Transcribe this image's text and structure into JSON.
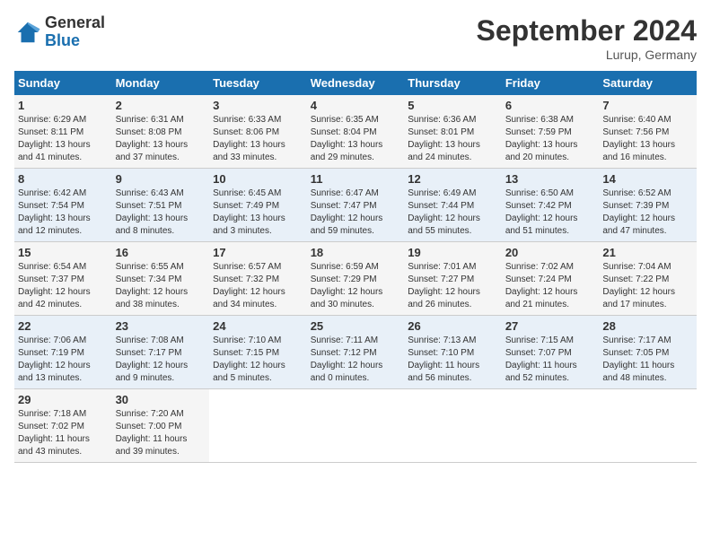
{
  "logo": {
    "general": "General",
    "blue": "Blue"
  },
  "title": "September 2024",
  "location": "Lurup, Germany",
  "columns": [
    "Sunday",
    "Monday",
    "Tuesday",
    "Wednesday",
    "Thursday",
    "Friday",
    "Saturday"
  ],
  "weeks": [
    [
      {
        "day": "1",
        "info": "Sunrise: 6:29 AM\nSunset: 8:11 PM\nDaylight: 13 hours\nand 41 minutes."
      },
      {
        "day": "2",
        "info": "Sunrise: 6:31 AM\nSunset: 8:08 PM\nDaylight: 13 hours\nand 37 minutes."
      },
      {
        "day": "3",
        "info": "Sunrise: 6:33 AM\nSunset: 8:06 PM\nDaylight: 13 hours\nand 33 minutes."
      },
      {
        "day": "4",
        "info": "Sunrise: 6:35 AM\nSunset: 8:04 PM\nDaylight: 13 hours\nand 29 minutes."
      },
      {
        "day": "5",
        "info": "Sunrise: 6:36 AM\nSunset: 8:01 PM\nDaylight: 13 hours\nand 24 minutes."
      },
      {
        "day": "6",
        "info": "Sunrise: 6:38 AM\nSunset: 7:59 PM\nDaylight: 13 hours\nand 20 minutes."
      },
      {
        "day": "7",
        "info": "Sunrise: 6:40 AM\nSunset: 7:56 PM\nDaylight: 13 hours\nand 16 minutes."
      }
    ],
    [
      {
        "day": "8",
        "info": "Sunrise: 6:42 AM\nSunset: 7:54 PM\nDaylight: 13 hours\nand 12 minutes."
      },
      {
        "day": "9",
        "info": "Sunrise: 6:43 AM\nSunset: 7:51 PM\nDaylight: 13 hours\nand 8 minutes."
      },
      {
        "day": "10",
        "info": "Sunrise: 6:45 AM\nSunset: 7:49 PM\nDaylight: 13 hours\nand 3 minutes."
      },
      {
        "day": "11",
        "info": "Sunrise: 6:47 AM\nSunset: 7:47 PM\nDaylight: 12 hours\nand 59 minutes."
      },
      {
        "day": "12",
        "info": "Sunrise: 6:49 AM\nSunset: 7:44 PM\nDaylight: 12 hours\nand 55 minutes."
      },
      {
        "day": "13",
        "info": "Sunrise: 6:50 AM\nSunset: 7:42 PM\nDaylight: 12 hours\nand 51 minutes."
      },
      {
        "day": "14",
        "info": "Sunrise: 6:52 AM\nSunset: 7:39 PM\nDaylight: 12 hours\nand 47 minutes."
      }
    ],
    [
      {
        "day": "15",
        "info": "Sunrise: 6:54 AM\nSunset: 7:37 PM\nDaylight: 12 hours\nand 42 minutes."
      },
      {
        "day": "16",
        "info": "Sunrise: 6:55 AM\nSunset: 7:34 PM\nDaylight: 12 hours\nand 38 minutes."
      },
      {
        "day": "17",
        "info": "Sunrise: 6:57 AM\nSunset: 7:32 PM\nDaylight: 12 hours\nand 34 minutes."
      },
      {
        "day": "18",
        "info": "Sunrise: 6:59 AM\nSunset: 7:29 PM\nDaylight: 12 hours\nand 30 minutes."
      },
      {
        "day": "19",
        "info": "Sunrise: 7:01 AM\nSunset: 7:27 PM\nDaylight: 12 hours\nand 26 minutes."
      },
      {
        "day": "20",
        "info": "Sunrise: 7:02 AM\nSunset: 7:24 PM\nDaylight: 12 hours\nand 21 minutes."
      },
      {
        "day": "21",
        "info": "Sunrise: 7:04 AM\nSunset: 7:22 PM\nDaylight: 12 hours\nand 17 minutes."
      }
    ],
    [
      {
        "day": "22",
        "info": "Sunrise: 7:06 AM\nSunset: 7:19 PM\nDaylight: 12 hours\nand 13 minutes."
      },
      {
        "day": "23",
        "info": "Sunrise: 7:08 AM\nSunset: 7:17 PM\nDaylight: 12 hours\nand 9 minutes."
      },
      {
        "day": "24",
        "info": "Sunrise: 7:10 AM\nSunset: 7:15 PM\nDaylight: 12 hours\nand 5 minutes."
      },
      {
        "day": "25",
        "info": "Sunrise: 7:11 AM\nSunset: 7:12 PM\nDaylight: 12 hours\nand 0 minutes."
      },
      {
        "day": "26",
        "info": "Sunrise: 7:13 AM\nSunset: 7:10 PM\nDaylight: 11 hours\nand 56 minutes."
      },
      {
        "day": "27",
        "info": "Sunrise: 7:15 AM\nSunset: 7:07 PM\nDaylight: 11 hours\nand 52 minutes."
      },
      {
        "day": "28",
        "info": "Sunrise: 7:17 AM\nSunset: 7:05 PM\nDaylight: 11 hours\nand 48 minutes."
      }
    ],
    [
      {
        "day": "29",
        "info": "Sunrise: 7:18 AM\nSunset: 7:02 PM\nDaylight: 11 hours\nand 43 minutes."
      },
      {
        "day": "30",
        "info": "Sunrise: 7:20 AM\nSunset: 7:00 PM\nDaylight: 11 hours\nand 39 minutes."
      },
      null,
      null,
      null,
      null,
      null
    ]
  ]
}
